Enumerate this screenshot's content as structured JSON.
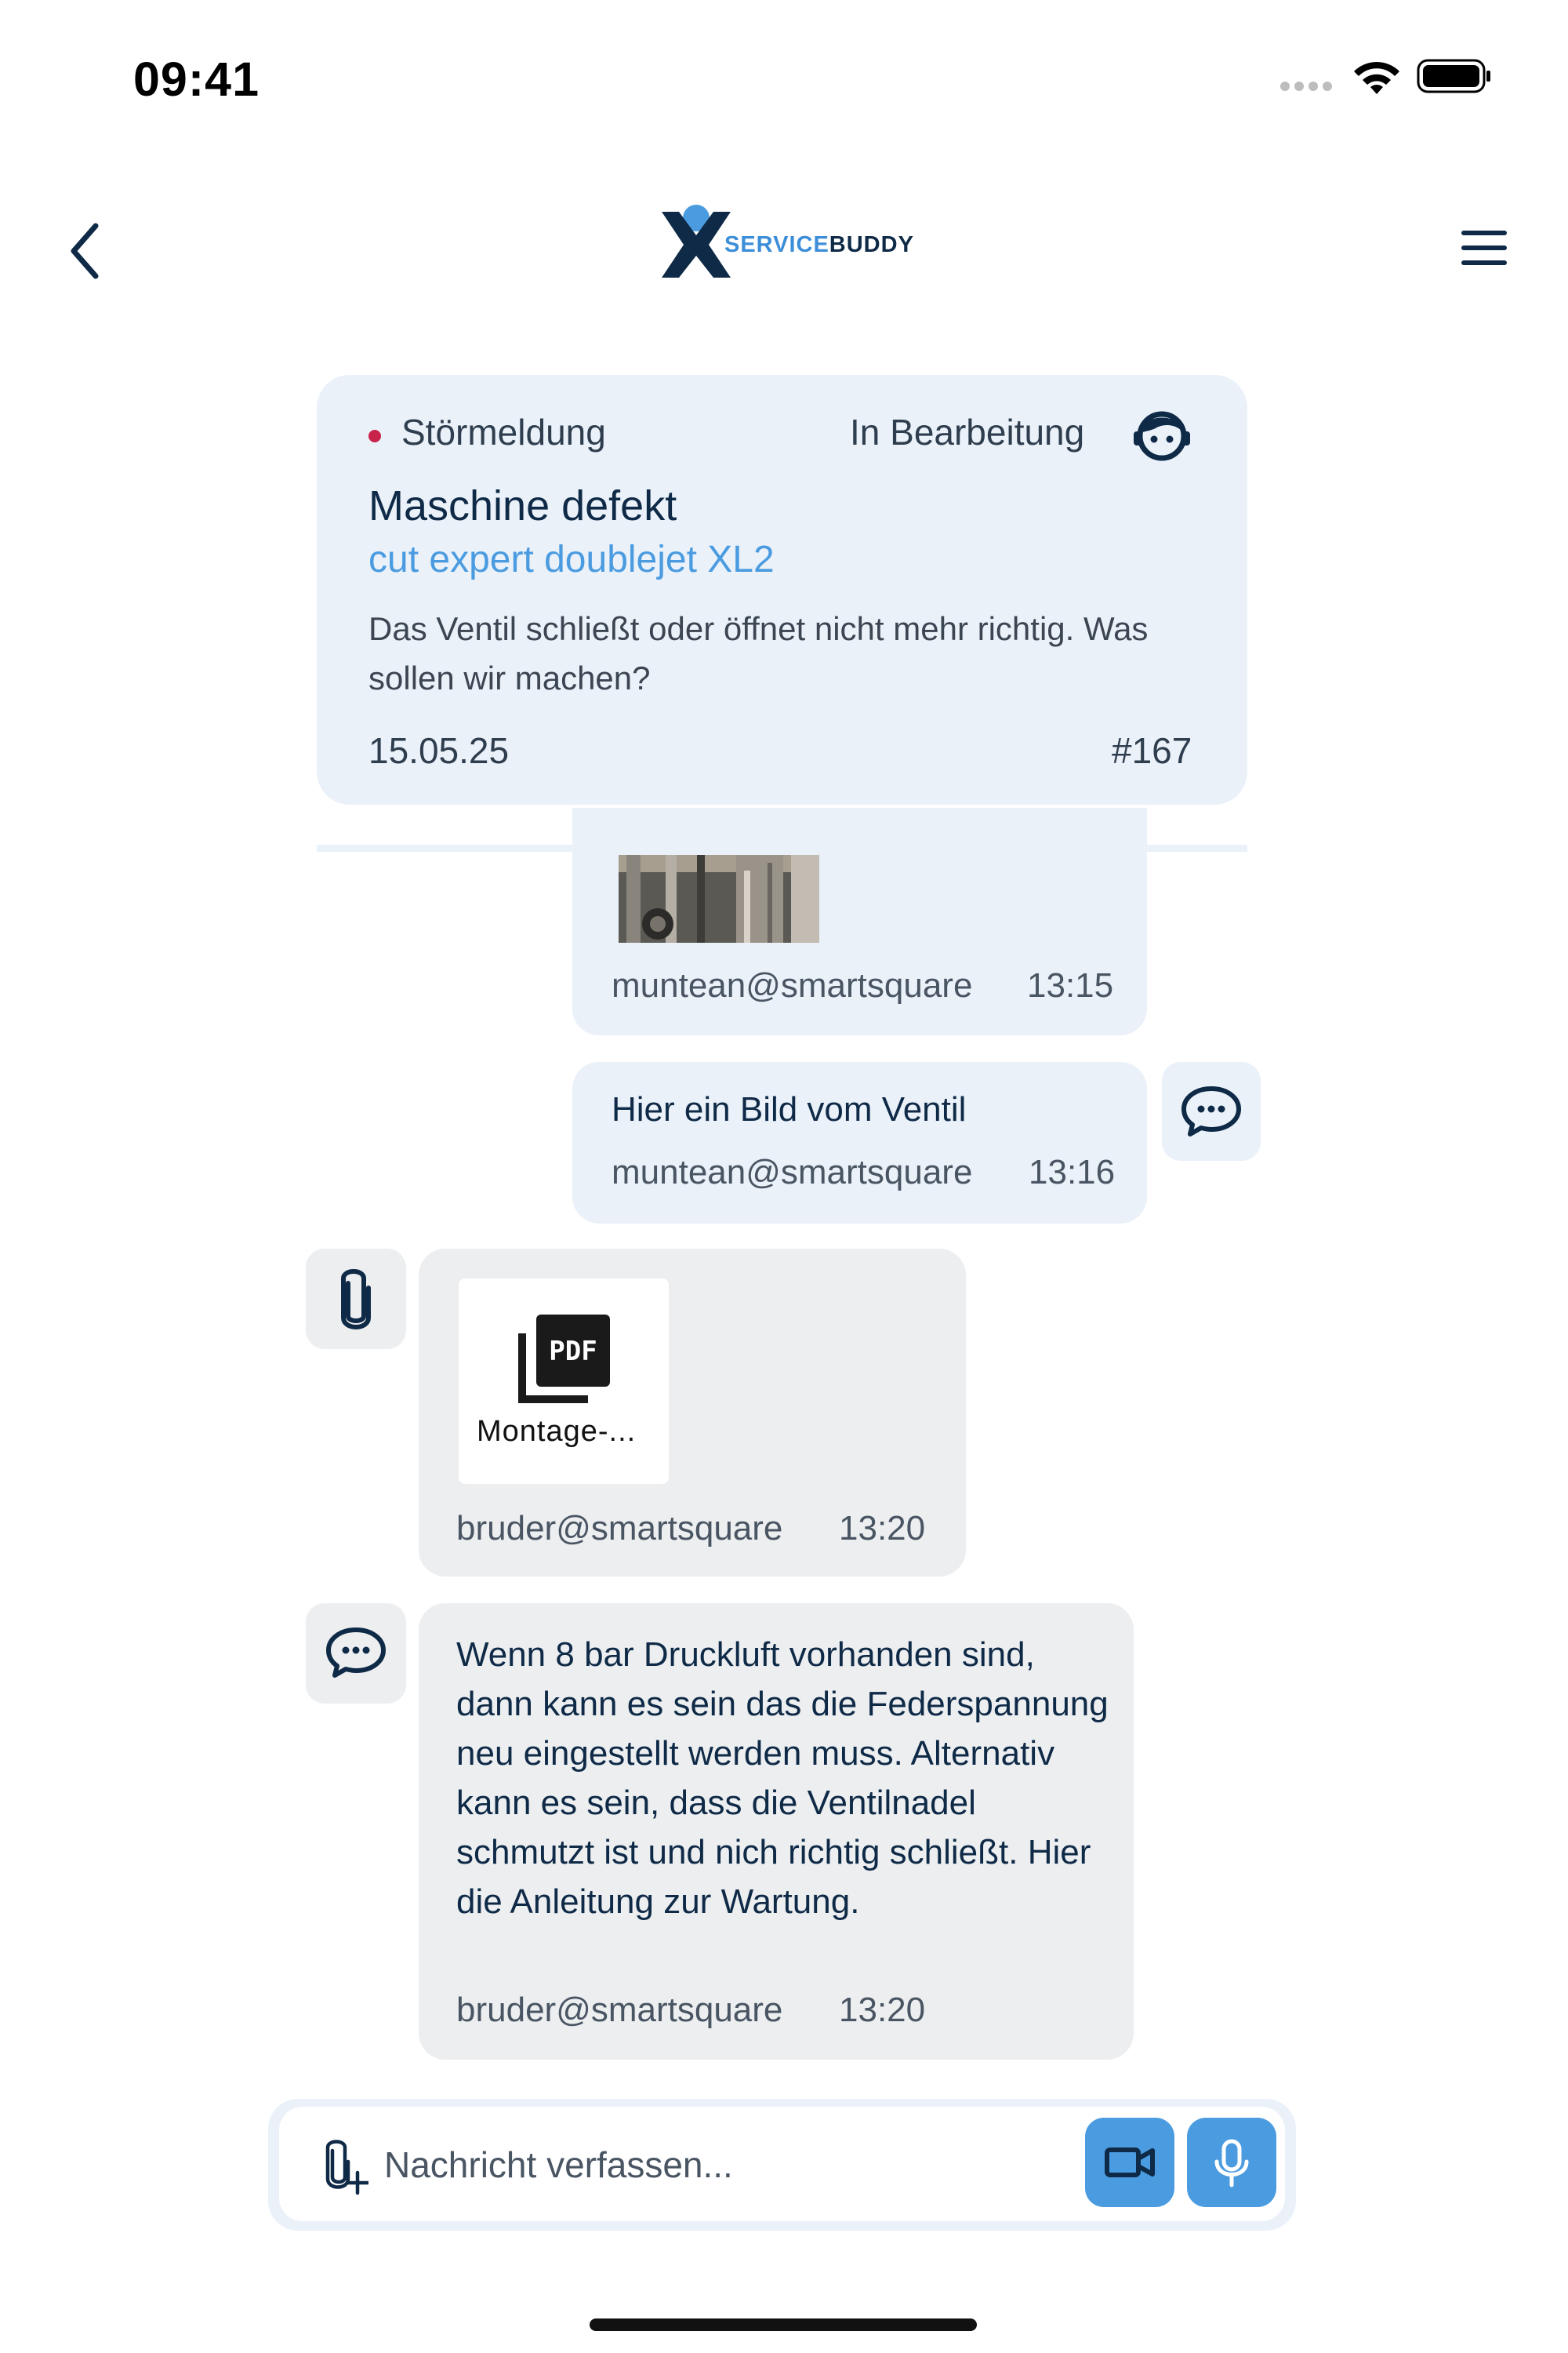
{
  "status_bar": {
    "time": "09:41"
  },
  "header": {
    "logo_text_part1": "SERVICE",
    "logo_text_part2": "BUDDY"
  },
  "ticket": {
    "type": "Störmeldung",
    "status": "In Bearbeitung",
    "title": "Maschine defekt",
    "machine": "cut expert doublejet XL2",
    "description": "Das Ventil schließt oder öffnet nicht mehr richtig. Was sollen wir machen?",
    "date": "15.05.25",
    "number": "#167"
  },
  "messages": [
    {
      "sender": "muntean@smartsquare",
      "time": "13:15"
    },
    {
      "text": "Hier ein Bild vom Ventil",
      "sender": "muntean@smartsquare",
      "time": "13:16"
    },
    {
      "attachment_name": "Montage-...",
      "sender": "bruder@smartsquare",
      "time": "13:20"
    },
    {
      "text": "Wenn 8 bar Druckluft vorhanden sind, dann kann es sein das die Federspannung neu eingestellt werden muss. Alternativ kann es sein, dass die Ventilnadel schmutzt ist und nich richtig schließt. Hier die Anleitung zur Wartung.",
      "sender": "bruder@smartsquare",
      "time": "13:20"
    }
  ],
  "composer": {
    "placeholder": "Nachricht verfassen..."
  },
  "colors": {
    "navy": "#0f2a47",
    "accent": "#4a9be0",
    "bubble_blue": "#eaf1f9",
    "bubble_grey": "#eceef0",
    "status_dot": "#c8234a"
  }
}
